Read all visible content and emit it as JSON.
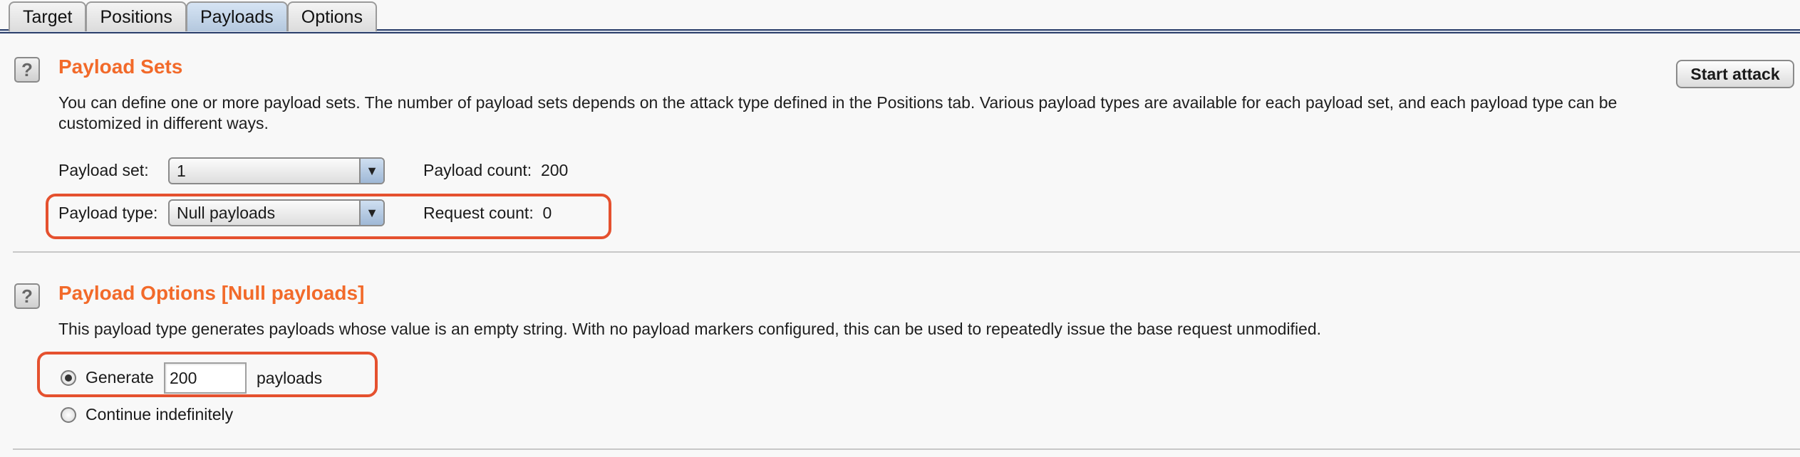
{
  "tabs": [
    {
      "label": "Target"
    },
    {
      "label": "Positions"
    },
    {
      "label": "Payloads"
    },
    {
      "label": "Options"
    }
  ],
  "active_tab": "Payloads",
  "toolbar": {
    "start_attack_label": "Start attack"
  },
  "payload_sets": {
    "help_icon": "?",
    "title": "Payload Sets",
    "description": "You can define one or more payload sets. The number of payload sets depends on the attack type defined in the Positions tab. Various payload types are available for each payload set, and each payload type can be customized in different ways.",
    "set_label": "Payload set:",
    "set_value": "1",
    "count_label": "Payload count:",
    "count_value": "200",
    "type_label": "Payload type:",
    "type_value": "Null payloads",
    "request_label": "Request count:",
    "request_value": "0"
  },
  "payload_options": {
    "help_icon": "?",
    "title": "Payload Options [Null payloads]",
    "description": "This payload type generates payloads whose value is an empty string. With no payload markers configured, this can be used to repeatedly issue the base request unmodified.",
    "generate_label": "Generate",
    "generate_value": "200",
    "generate_suffix": "payloads",
    "generate_selected": true,
    "continue_label": "Continue indefinitely",
    "continue_selected": false
  },
  "colors": {
    "accent_title": "#f26a2a",
    "highlight": "#e5512f"
  },
  "icons": {
    "help": "help-icon",
    "dropdown": "chevron-down-icon",
    "radio_selected": "radio-selected-icon",
    "radio_unselected": "radio-unselected-icon"
  }
}
